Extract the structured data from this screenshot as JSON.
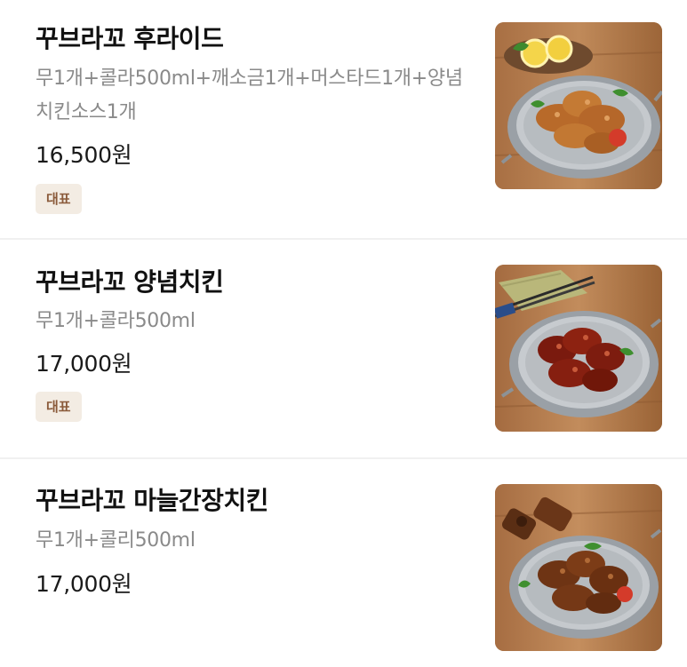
{
  "menu": {
    "items": [
      {
        "name": "꾸브라꼬 후라이드",
        "description": "무1개+콜라500ml+깨소금1개+머스타드1개+양념치킨소스1개",
        "price": "16,500원",
        "badge": "대표",
        "image_icon": "fried-chicken-photo"
      },
      {
        "name": "꾸브라꼬 양념치킨",
        "description": "무1개+콜라500ml",
        "price": "17,000원",
        "badge": "대표",
        "image_icon": "seasoned-chicken-photo"
      },
      {
        "name": "꾸브라꼬 마늘간장치킨",
        "description": "무1개+콜리500ml",
        "price": "17,000원",
        "image_icon": "garlic-soy-chicken-photo"
      }
    ]
  },
  "colors": {
    "badge_bg": "#f3ece3",
    "badge_text": "#8a5a3a",
    "description_text": "#8a8a8a",
    "divider": "#f0f0f0"
  }
}
